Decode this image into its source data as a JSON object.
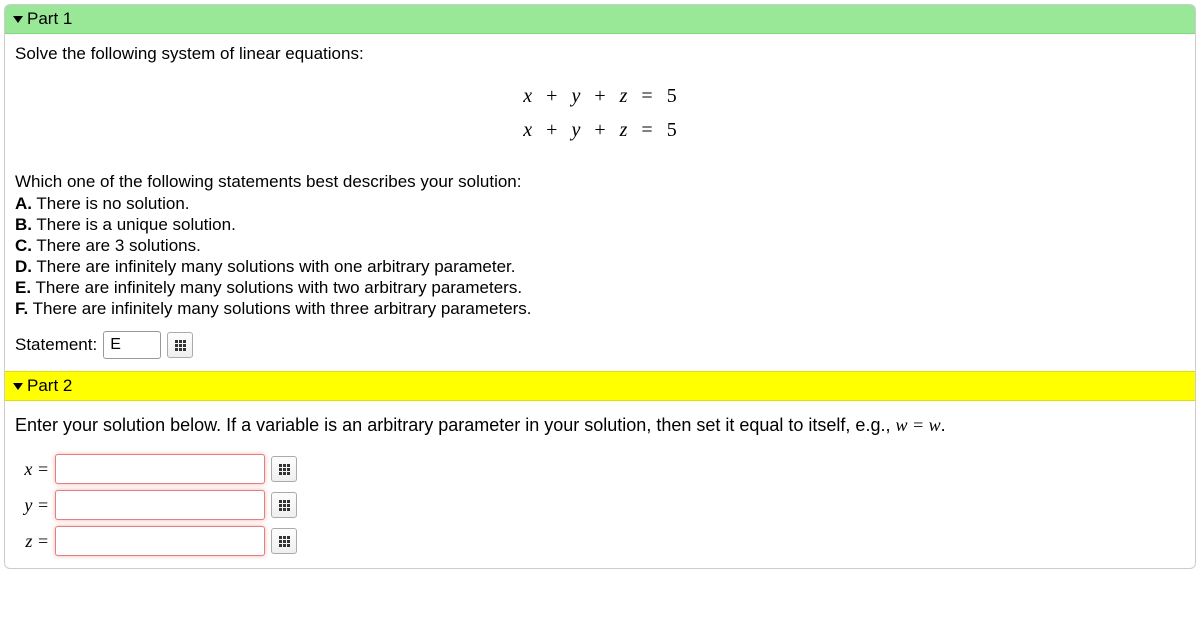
{
  "part1": {
    "title": "Part 1",
    "prompt": "Solve the following system of linear equations:",
    "eq": {
      "r1": {
        "a": "x",
        "p1": "+",
        "b": "y",
        "p2": "+",
        "c": "z",
        "eq": "=",
        "rhs": "5"
      },
      "r2": {
        "a": "x",
        "p1": "+",
        "b": "y",
        "p2": "+",
        "c": "z",
        "eq": "=",
        "rhs": "5"
      }
    },
    "question": "Which one of the following statements best describes your solution:",
    "options": {
      "A": {
        "letter": "A.",
        "text": " There is no solution."
      },
      "B": {
        "letter": "B.",
        "text": " There is a unique solution."
      },
      "C": {
        "letter": "C.",
        "text": " There are 3 solutions."
      },
      "D": {
        "letter": "D.",
        "text": " There are infinitely many solutions with one arbitrary parameter."
      },
      "E": {
        "letter": "E.",
        "text": " There are infinitely many solutions with two arbitrary parameters."
      },
      "F": {
        "letter": "F.",
        "text": " There are infinitely many solutions with three arbitrary parameters."
      }
    },
    "statement_label": "Statement:",
    "statement_value": "E"
  },
  "part2": {
    "title": "Part 2",
    "instruction_a": "Enter your solution below. If a variable is an arbitrary parameter in your solution, then set it equal to itself, e.g., ",
    "instruction_b": "w = w",
    "instruction_c": ".",
    "vars": {
      "x": {
        "label": "x =",
        "value": ""
      },
      "y": {
        "label": "y =",
        "value": ""
      },
      "z": {
        "label": "z =",
        "value": ""
      }
    }
  }
}
